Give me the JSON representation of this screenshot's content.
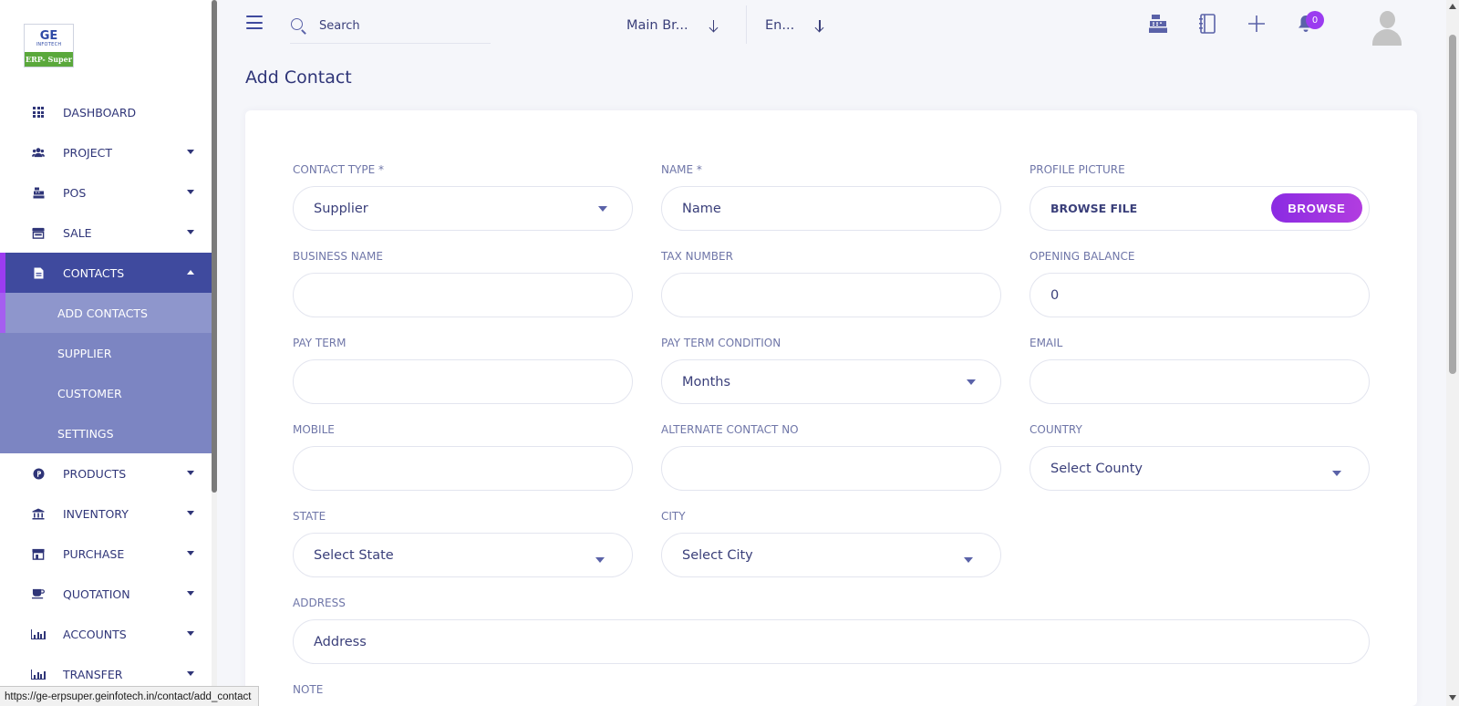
{
  "brand": {
    "logo_mark": "GE",
    "logo_word": "INFOTECH",
    "logo_product": "ERP- Super"
  },
  "sidebar": {
    "items": [
      {
        "label": "DASHBOARD",
        "icon": "grid-icon"
      },
      {
        "label": "PROJECT",
        "icon": "users-icon",
        "has_caret": true
      },
      {
        "label": "POS",
        "icon": "cash-register-icon",
        "has_caret": true
      },
      {
        "label": "SALE",
        "icon": "store-icon",
        "has_caret": true
      },
      {
        "label": "CONTACTS",
        "icon": "contact-file-icon",
        "has_caret": true,
        "expanded": true
      },
      {
        "label": "PRODUCTS",
        "icon": "product-p-icon",
        "has_caret": true
      },
      {
        "label": "INVENTORY",
        "icon": "bank-icon",
        "has_caret": true
      },
      {
        "label": "PURCHASE",
        "icon": "shop-icon",
        "has_caret": true
      },
      {
        "label": "QUOTATION",
        "icon": "coffee-icon",
        "has_caret": true
      },
      {
        "label": "ACCOUNTS",
        "icon": "bar-chart-icon",
        "has_caret": true
      },
      {
        "label": "TRANSFER",
        "icon": "bar-chart-icon",
        "has_caret": true
      }
    ],
    "contacts_submenu": [
      {
        "label": "ADD CONTACTS",
        "active": true
      },
      {
        "label": "SUPPLIER"
      },
      {
        "label": "CUSTOMER"
      },
      {
        "label": "SETTINGS"
      }
    ]
  },
  "header": {
    "search_placeholder": "Search",
    "branch": "Main Br...",
    "language": "En...",
    "notification_count": "0"
  },
  "page": {
    "title": "Add Contact"
  },
  "form": {
    "contact_type": {
      "label": "CONTACT TYPE *",
      "value": "Supplier"
    },
    "name": {
      "label": "NAME *",
      "placeholder": "Name"
    },
    "profile_picture": {
      "label": "PROFILE PICTURE",
      "file_text": "BROWSE FILE",
      "button": "BROWSE"
    },
    "business_name": {
      "label": "BUSINESS NAME",
      "value": ""
    },
    "tax_number": {
      "label": "TAX NUMBER",
      "value": ""
    },
    "opening_balance": {
      "label": "OPENING BALANCE",
      "value": "0"
    },
    "pay_term": {
      "label": "PAY TERM",
      "value": ""
    },
    "pay_term_condition": {
      "label": "PAY TERM CONDITION",
      "value": "Months"
    },
    "email": {
      "label": "EMAIL",
      "value": ""
    },
    "mobile": {
      "label": "MOBILE",
      "value": ""
    },
    "alternate_contact": {
      "label": "ALTERNATE CONTACT NO",
      "value": ""
    },
    "country": {
      "label": "COUNTRY",
      "value": "Select County"
    },
    "state": {
      "label": "STATE",
      "value": "Select State"
    },
    "city": {
      "label": "CITY",
      "value": "Select City"
    },
    "address": {
      "label": "ADDRESS",
      "placeholder": "Address"
    },
    "note": {
      "label": "NOTE"
    }
  },
  "status_bar": {
    "url": "https://ge-erpsuper.geinfotech.in/contact/add_contact"
  },
  "colors": {
    "primary": "#3f4a9e",
    "accent": "#9b3cf0",
    "submenu_bg": "#7c85c2"
  }
}
